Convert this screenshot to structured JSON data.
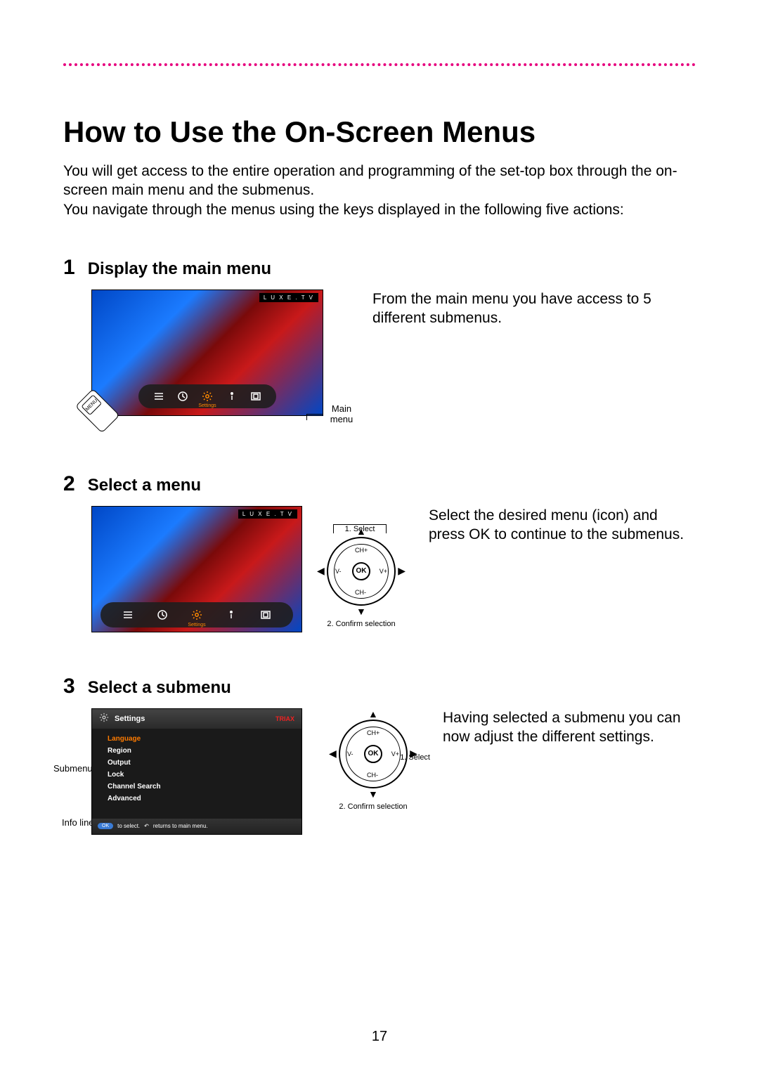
{
  "page_number": "17",
  "title": "How to Use the On-Screen Menus",
  "intro_1": "You will get access to the entire operation and programming of the set-top box through the on-screen main menu and the submenus.",
  "intro_2": "You navigate through the menus using the keys displayed in the following five actions:",
  "steps": [
    {
      "num": "1",
      "title": "Display the main menu",
      "desc": "From the main menu you have access to 5 different submenus."
    },
    {
      "num": "2",
      "title": "Select a menu",
      "desc": "Select the desired menu (icon) and press OK to continue to the submenus."
    },
    {
      "num": "3",
      "title": "Select a submenu",
      "desc": "Having selected a submenu you can now adjust the different settings."
    }
  ],
  "tv": {
    "channel_tag": "L U X E . T V",
    "icon_label": "Settings",
    "label_main_menu": "Main menu",
    "remote_menu_key": "MENU"
  },
  "dpad": {
    "ok": "OK",
    "ch_plus": "CH+",
    "ch_minus": "CH-",
    "v_plus": "V+",
    "v_minus": "V-",
    "select_caption": "1. Select",
    "confirm_caption": "2. Confirm selection"
  },
  "settings_menu": {
    "title": "Settings",
    "brand": "TRIAX",
    "items": [
      "Language",
      "Region",
      "Output",
      "Lock",
      "Channel Search",
      "Advanced"
    ],
    "info_ok": "OK",
    "info_ok_text": "to select.",
    "info_back_text": "returns to main menu.",
    "label_submenu": "Submenu",
    "label_info": "Info line",
    "side_select": "1. Select"
  }
}
